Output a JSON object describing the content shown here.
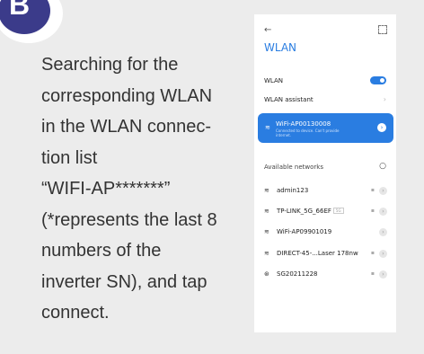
{
  "step": {
    "letter": "B"
  },
  "instruction": {
    "lines": [
      "Searching for the",
      "corresponding WLAN",
      "in the WLAN connec-",
      "tion list",
      "“WIFI-AP*******”",
      "(*represents the last 8",
      "numbers of the",
      "inverter SN), and tap",
      "connect."
    ]
  },
  "phone": {
    "title": "WLAN",
    "wlan_label": "WLAN",
    "wlan_enabled": true,
    "assistant_label": "WLAN assistant",
    "connected": {
      "name": "WiFi-AP00130008",
      "status": "Connected to device. Can't provide internet."
    },
    "available_label": "Available networks",
    "networks": [
      {
        "name": "admin123",
        "icon": "wifi-icon",
        "tag": ""
      },
      {
        "name": "TP-LINK_5G_66EF",
        "icon": "wifi-icon",
        "tag": "5G"
      },
      {
        "name": "WiFi-AP09901019",
        "icon": "wifi-icon",
        "tag": ""
      },
      {
        "name": "DIRECT-45-...Laser 178nw",
        "icon": "wifi-icon",
        "tag": ""
      },
      {
        "name": "SG20211228",
        "icon": "wifi-link-icon",
        "tag": ""
      }
    ]
  },
  "colors": {
    "accent": "#2a7de1",
    "badge": "#3b3b8a",
    "background": "#ececec"
  }
}
